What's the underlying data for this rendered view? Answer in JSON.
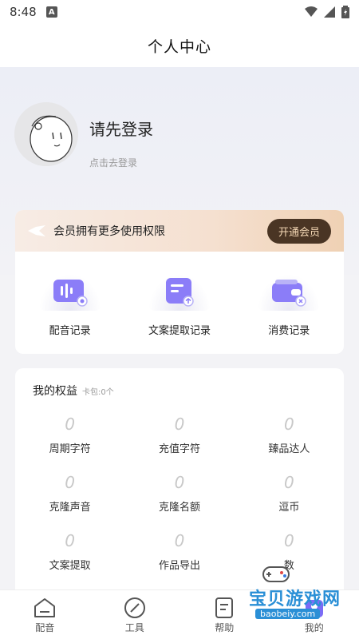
{
  "status_bar": {
    "time": "8:48",
    "notification_badge": "A"
  },
  "header": {
    "title": "个人中心"
  },
  "profile": {
    "login_title": "请先登录",
    "login_subtitle": "点击去登录"
  },
  "vip": {
    "text": "会员拥有更多使用权限",
    "button": "开通会员"
  },
  "records": [
    {
      "label": "配音记录",
      "icon": "voice-record-icon"
    },
    {
      "label": "文案提取记录",
      "icon": "text-extract-icon"
    },
    {
      "label": "消费记录",
      "icon": "wallet-icon"
    }
  ],
  "benefits": {
    "title": "我的权益",
    "card_label": "卡包:",
    "card_count": "0个",
    "items": [
      {
        "value": "0",
        "label": "周期字符"
      },
      {
        "value": "0",
        "label": "充值字符"
      },
      {
        "value": "0",
        "label": "臻品达人"
      },
      {
        "value": "0",
        "label": "克隆声音"
      },
      {
        "value": "0",
        "label": "克隆名额"
      },
      {
        "value": "0",
        "label": "逗币"
      },
      {
        "value": "0",
        "label": "文案提取"
      },
      {
        "value": "0",
        "label": "作品导出"
      },
      {
        "value": "0",
        "label": "数"
      }
    ]
  },
  "tabbar": {
    "items": [
      {
        "label": "配音",
        "icon": "home-icon"
      },
      {
        "label": "工具",
        "icon": "compass-icon"
      },
      {
        "label": "帮助",
        "icon": "document-icon"
      },
      {
        "label": "我的",
        "icon": "profile-icon"
      }
    ]
  },
  "watermark": {
    "text": "宝贝游戏网",
    "url": "baobeiy.com"
  },
  "colors": {
    "accent": "#7b6cf6",
    "vip_button_bg": "#4a3524",
    "vip_button_text": "#f5d9b6",
    "watermark": "#2a8fd6"
  }
}
